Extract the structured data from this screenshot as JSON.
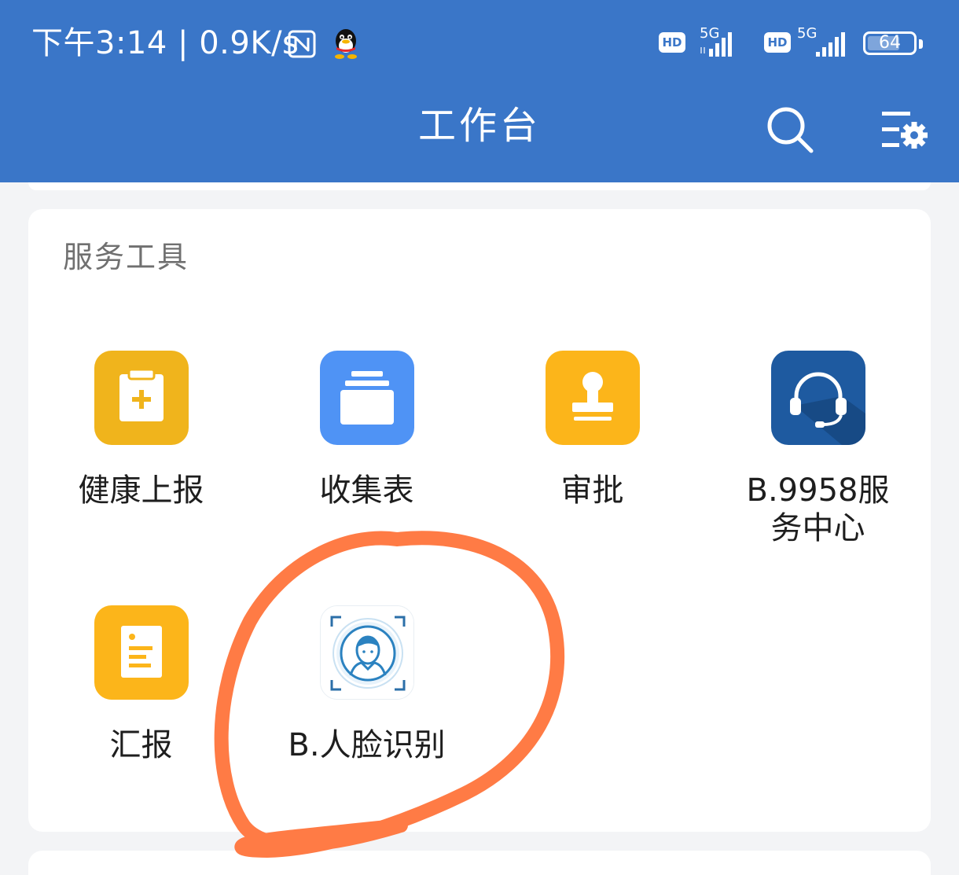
{
  "status_bar": {
    "time_speed": "下午3:14 | 0.9K/s",
    "network_1": "5G",
    "network_2": "5G",
    "hd_1": "HD",
    "hd_2": "HD",
    "battery": "64",
    "battery_level": 0.64,
    "icons": [
      "nfc-icon",
      "qq-icon",
      "signal-icon",
      "battery-icon"
    ]
  },
  "header": {
    "title": "工作台",
    "background": "#3a76c8",
    "icons": [
      "search-icon",
      "settings-icon"
    ]
  },
  "services": {
    "title": "服务工具",
    "tools": [
      {
        "label": "健康上报",
        "icon": "health-report-icon",
        "color": "#f0b41c"
      },
      {
        "label": "收集表",
        "icon": "collect-form-icon",
        "color": "#4f93f5"
      },
      {
        "label": "审批",
        "icon": "approval-stamp-icon",
        "color": "#fcb51a"
      },
      {
        "label": "B.9958服\n务中心",
        "icon": "headset-icon",
        "color": "#1e5aa0"
      },
      {
        "label": "汇报",
        "icon": "report-icon",
        "color": "#fcb51a"
      },
      {
        "label": "B.人脸识别",
        "icon": "face-recognition-icon",
        "color": "#2b82c0"
      }
    ]
  },
  "annotation": {
    "shape": "hand-drawn circle",
    "color": "#ff7b45"
  }
}
